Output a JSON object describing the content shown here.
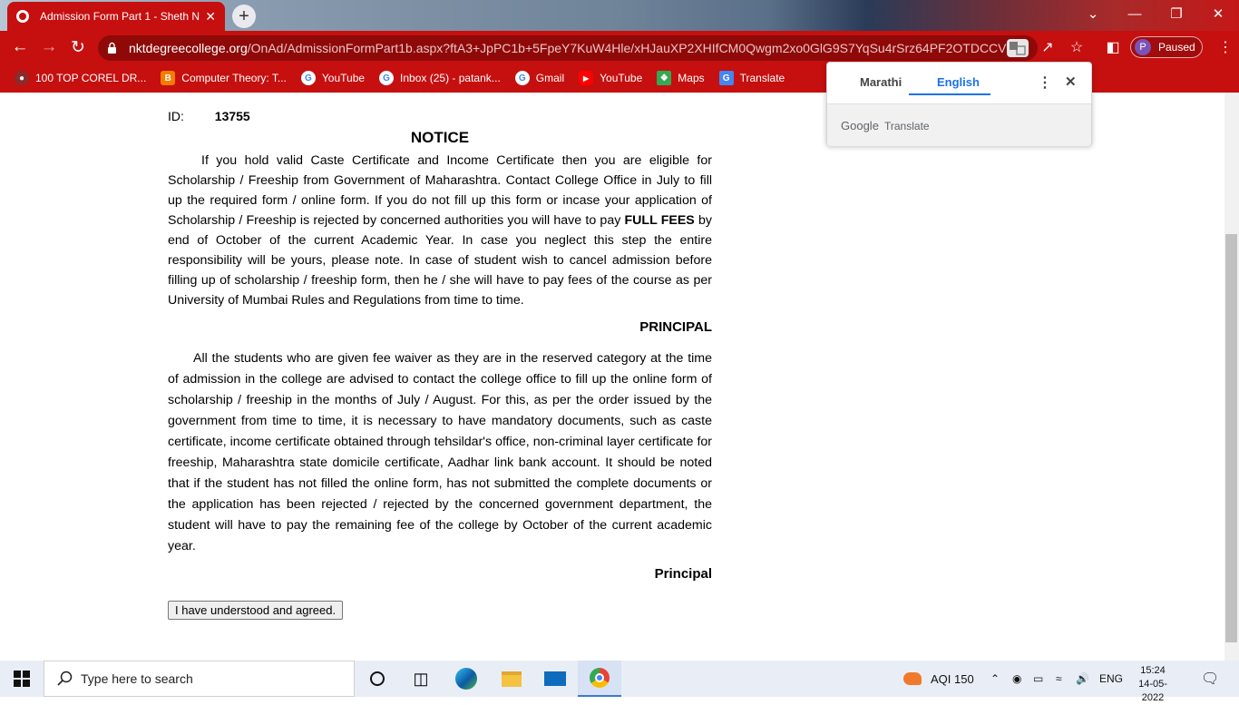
{
  "browser": {
    "tab_title": "Admission Form Part 1 - Sheth N",
    "tab_close": "✕",
    "new_tab": "+",
    "url_domain": "nktdegreecollege.org",
    "url_path": "/OnAd/AdmissionFormPart1b.aspx?ftA3+JpPC1b+5FpeY7KuW4Hle/xHJauXP2XHIfCM0Qwgm2xo0GlG9S7YqSu4rSrz64PF2OTDCCVTt...",
    "profile_initial": "P",
    "profile_status": "Paused",
    "accent_color": "#c60f0f"
  },
  "bookmarks": [
    {
      "label": "100 TOP COREL DR...",
      "icon": "corel-icon",
      "color": "#8b2b2b"
    },
    {
      "label": "Computer Theory: T...",
      "icon": "blogger-icon",
      "color": "#f57c00"
    },
    {
      "label": "YouTube",
      "icon": "google-icon",
      "color": "#ffffff"
    },
    {
      "label": "Inbox (25) - patank...",
      "icon": "google-icon",
      "color": "#ffffff"
    },
    {
      "label": "Gmail",
      "icon": "google-icon",
      "color": "#ffffff"
    },
    {
      "label": "YouTube",
      "icon": "youtube-icon",
      "color": "#ff0000"
    },
    {
      "label": "Maps",
      "icon": "maps-icon",
      "color": "#34a853"
    },
    {
      "label": "Translate",
      "icon": "translate-icon",
      "color": "#4285f4"
    }
  ],
  "page": {
    "id_label": "ID:",
    "id_value": "13755",
    "notice_title": "NOTICE",
    "para1_a": "If you hold valid Caste Certificate and Income Certificate then you are eligible for Scholarship / Freeship from Government of Maharashtra. Contact College Office in July to fill up the required form / online form. If you do not fill up this form or incase your application of Scholarship / Freeship is rejected by concerned authorities you will have to pay ",
    "para1_bold": "FULL FEES",
    "para1_b": " by end of October of the current Academic Year. In case you neglect this step the entire responsibility will be yours, please note. In case of student wish to cancel admission before filling up of scholarship / freeship form, then he / she will have to pay fees of the course as per University of Mumbai Rules and Regulations from time to time.",
    "signature1": "PRINCIPAL",
    "para2": "All the students who are given fee waiver as they are in the reserved category at the time of admission in the college are advised to contact the college office to fill up the online form of scholarship / freeship in the months of July / August. For this, as per the order issued by the government from time to time, it is necessary to have mandatory documents, such as caste certificate, income certificate obtained through tehsildar's office, non-criminal layer certificate for freeship, Maharashtra state domicile certificate, Aadhar link bank account. It should be noted that if the student has not filled the online form, has not submitted the complete documents or the application has been rejected / rejected by the concerned government department, the student will have to pay the remaining fee of the college by October of the current academic year.",
    "signature2": "Principal",
    "agree_button": "I have understood and agreed."
  },
  "translate_popup": {
    "tab_source": "Marathi",
    "tab_target": "English",
    "brand_google": "Google",
    "brand_translate": "Translate",
    "close": "✕",
    "menu": "⋮"
  },
  "taskbar": {
    "search_placeholder": "Type here to search",
    "aqi": "AQI 150",
    "language": "ENG",
    "time": "15:24",
    "date": "14-05-2022"
  }
}
